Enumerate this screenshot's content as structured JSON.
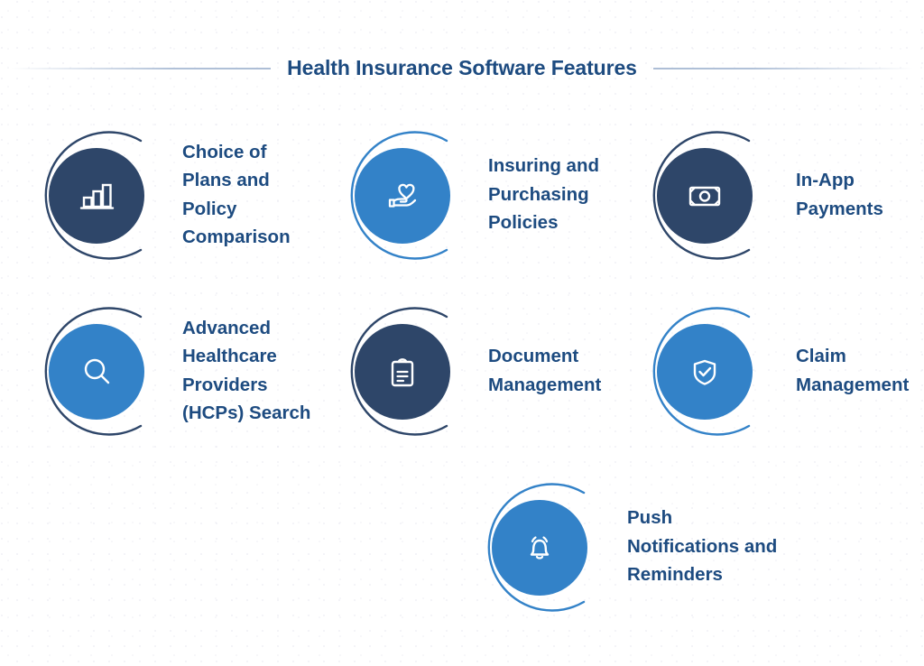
{
  "header": {
    "title": "Health Insurance Software Features",
    "rule_left": "divider-line",
    "rule_right": "divider-line"
  },
  "colors": {
    "navy": "#2e4669",
    "blue": "#3382c8",
    "title_text": "#1d4b80",
    "label_text": "#1d4b80",
    "rule": "#adbed6",
    "background": "#ffffff",
    "icon": "#ffffff"
  },
  "features": [
    {
      "label": "Choice of Plans and Policy Comparison",
      "icon": "bar-chart-icon",
      "disc_color": "#2e4669",
      "arc_color": "#2e4669",
      "row": 1,
      "column": 1
    },
    {
      "label": "Insuring and Purchasing Policies",
      "icon": "hand-heart-icon",
      "disc_color": "#3382c8",
      "arc_color": "#3382c8",
      "row": 1,
      "column": 2
    },
    {
      "label": "In-App Payments",
      "icon": "banknote-icon",
      "disc_color": "#2e4669",
      "arc_color": "#2e4669",
      "row": 1,
      "column": 3
    },
    {
      "label": "Advanced Healthcare Providers (HCPs) Search",
      "icon": "magnifier-icon",
      "disc_color": "#3382c8",
      "arc_color": "#2e4669",
      "row": 2,
      "column": 1
    },
    {
      "label": "Document Management",
      "icon": "clipboard-icon",
      "disc_color": "#2e4669",
      "arc_color": "#2e4669",
      "row": 2,
      "column": 2
    },
    {
      "label": "Claim Management",
      "icon": "shield-check-icon",
      "disc_color": "#3382c8",
      "arc_color": "#3382c8",
      "row": 2,
      "column": 3
    },
    {
      "label": "Push Notifications and Reminders",
      "icon": "bell-icon",
      "disc_color": "#3382c8",
      "arc_color": "#3382c8",
      "row": 3,
      "column": 2
    }
  ]
}
